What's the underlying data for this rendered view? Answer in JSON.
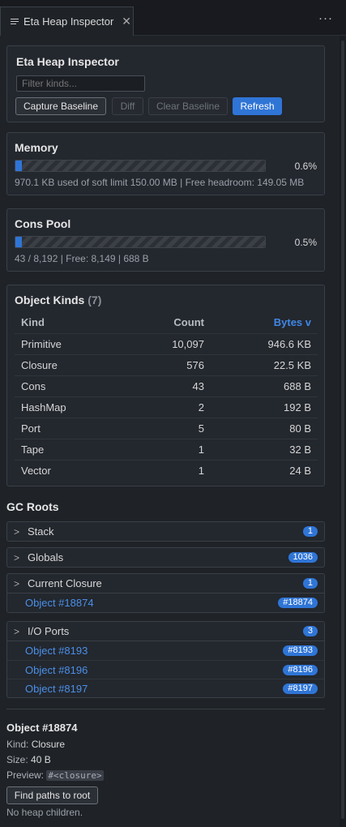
{
  "tab": {
    "title": "Eta Heap Inspector",
    "close": "✕",
    "more": "···"
  },
  "header": {
    "title": "Eta Heap Inspector",
    "filter_placeholder": "Filter kinds...",
    "buttons": {
      "capture": "Capture Baseline",
      "diff": "Diff",
      "clear": "Clear Baseline",
      "refresh": "Refresh"
    }
  },
  "memory": {
    "title": "Memory",
    "percent_label": "0.6%",
    "fraction": 0.006,
    "description": "970.1 KB used of soft limit 150.00 MB | Free headroom: 149.05 MB"
  },
  "cons_pool": {
    "title": "Cons Pool",
    "percent_label": "0.5%",
    "fraction": 0.005,
    "description": "43 / 8,192 | Free: 8,149 | 688 B"
  },
  "object_kinds": {
    "title": "Object Kinds",
    "count": "(7)",
    "columns": {
      "kind": "Kind",
      "count": "Count",
      "bytes": "Bytes v"
    },
    "rows": [
      {
        "kind": "Primitive",
        "count": "10,097",
        "bytes": "946.6 KB"
      },
      {
        "kind": "Closure",
        "count": "576",
        "bytes": "22.5 KB"
      },
      {
        "kind": "Cons",
        "count": "43",
        "bytes": "688 B"
      },
      {
        "kind": "HashMap",
        "count": "2",
        "bytes": "192 B"
      },
      {
        "kind": "Port",
        "count": "5",
        "bytes": "80 B"
      },
      {
        "kind": "Tape",
        "count": "1",
        "bytes": "32 B"
      },
      {
        "kind": "Vector",
        "count": "1",
        "bytes": "24 B"
      }
    ]
  },
  "gc_roots": {
    "title": "GC Roots",
    "chevron": ">",
    "groups": {
      "stack": {
        "label": "Stack",
        "badge": "1"
      },
      "globals": {
        "label": "Globals",
        "badge": "1036"
      },
      "closure": {
        "label": "Current Closure",
        "badge": "1",
        "items": [
          {
            "label": "Object #18874",
            "badge": "#18874"
          }
        ]
      },
      "io": {
        "label": "I/O Ports",
        "badge": "3",
        "items": [
          {
            "label": "Object #8193",
            "badge": "#8193"
          },
          {
            "label": "Object #8196",
            "badge": "#8196"
          },
          {
            "label": "Object #8197",
            "badge": "#8197"
          }
        ]
      }
    }
  },
  "details": {
    "title": "Object #18874",
    "kind_key": "Kind:",
    "kind_value": "Closure",
    "size_key": "Size:",
    "size_value": "40 B",
    "preview_key": "Preview:",
    "preview_value": "#<closure>",
    "paths_button": "Find paths to root",
    "no_children": "No heap children."
  },
  "colors": {
    "accent": "#2f75d6",
    "link": "#4a90e8",
    "background": "#1f2328"
  }
}
